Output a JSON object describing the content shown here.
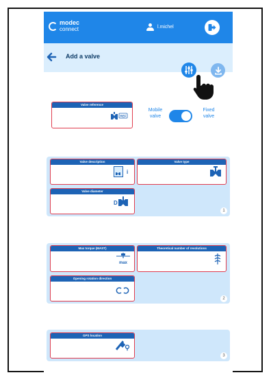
{
  "app": {
    "brand_line1": "modec",
    "brand_line2": "connect"
  },
  "user": {
    "name": "l.michel"
  },
  "page": {
    "title": "Add a valve"
  },
  "valve_reference": {
    "label": "Valve reference",
    "badge": "REF"
  },
  "mount_toggle": {
    "left_label": "Mobile\nvalve",
    "right_label": "Fixed\nvalve",
    "state": "fixed"
  },
  "section1": {
    "number": "1",
    "fields": [
      {
        "label": "Valve description",
        "icon": "description-icon"
      },
      {
        "label": "Valve type",
        "icon": "valve-type-icon"
      },
      {
        "label": "Valve diameter",
        "icon": "diameter-icon",
        "badge": "D"
      }
    ]
  },
  "section2": {
    "number": "2",
    "fields": [
      {
        "label": "Max torque (MAST)",
        "icon": "torque-icon",
        "badge": "max"
      },
      {
        "label": "Theoretical number of revolutions",
        "icon": "revolutions-icon"
      },
      {
        "label": "Opening rotation direction",
        "icon": "rotation-direction-icon"
      }
    ]
  },
  "section3": {
    "number": "3",
    "fields": [
      {
        "label": "GPS location",
        "icon": "gps-icon"
      }
    ]
  },
  "colors": {
    "primary": "#1f86e8",
    "header_dark": "#1d63b5",
    "field_border": "#e03b4d",
    "section_bg": "#cfe7fb"
  }
}
